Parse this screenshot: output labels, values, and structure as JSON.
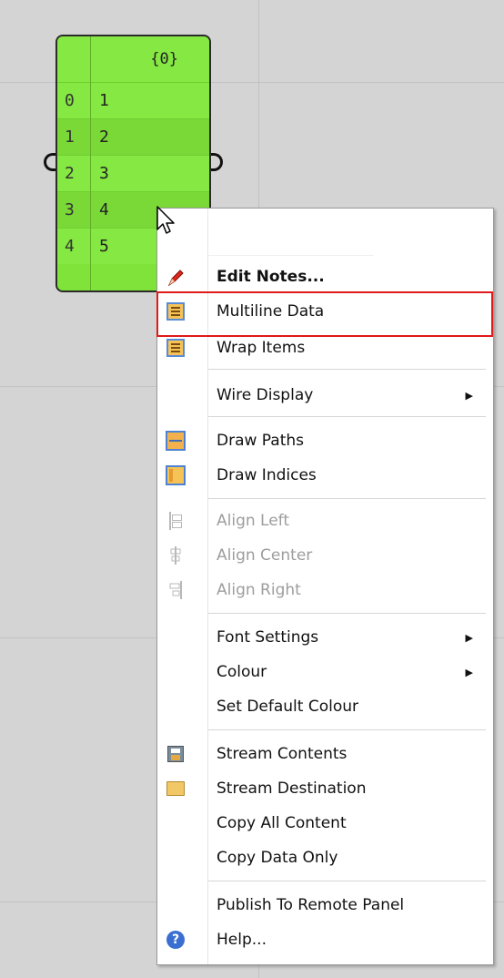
{
  "panel": {
    "header": "{0}",
    "rows": [
      {
        "index": "0",
        "value": "1"
      },
      {
        "index": "1",
        "value": "2"
      },
      {
        "index": "2",
        "value": "3"
      },
      {
        "index": "3",
        "value": "4"
      },
      {
        "index": "4",
        "value": "5"
      }
    ]
  },
  "menu": {
    "items": [
      {
        "label": "Edit Notes...",
        "icon": "pencil-icon"
      },
      {
        "label": "Multiline Data",
        "icon": "multiline-icon"
      },
      {
        "label": "Wrap Items",
        "icon": "wrap-icon"
      },
      {
        "label": "Wire Display",
        "submenu_arrow": "▶"
      },
      {
        "label": "Draw Paths",
        "icon": "paths-icon"
      },
      {
        "label": "Draw Indices",
        "icon": "indices-icon"
      },
      {
        "label": "Align Left",
        "icon": "align-left-icon"
      },
      {
        "label": "Align Center",
        "icon": "align-center-icon"
      },
      {
        "label": "Align Right",
        "icon": "align-right-icon"
      },
      {
        "label": "Font Settings",
        "submenu_arrow": "▶"
      },
      {
        "label": "Colour",
        "submenu_arrow": "▶"
      },
      {
        "label": "Set Default Colour"
      },
      {
        "label": "Stream Contents",
        "icon": "save-icon"
      },
      {
        "label": "Stream Destination",
        "icon": "folder-icon"
      },
      {
        "label": "Copy All Content"
      },
      {
        "label": "Copy Data Only"
      },
      {
        "label": "Publish To Remote Panel"
      },
      {
        "label": "Help...",
        "icon": "help-icon"
      }
    ]
  },
  "colors": {
    "panel_fill": "#7fe33a",
    "highlight": "#e01a1a",
    "disabled_text": "#9d9d9d"
  }
}
